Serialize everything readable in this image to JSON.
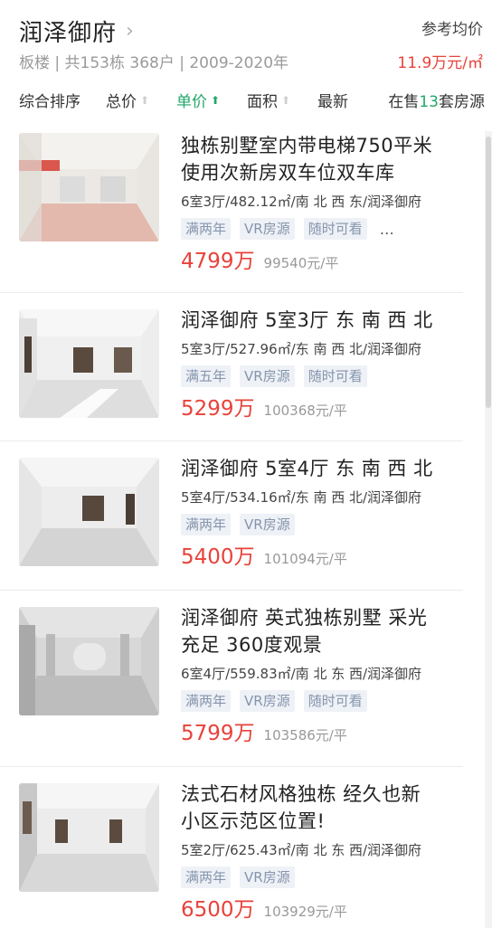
{
  "header": {
    "estate_name": "润泽御府",
    "chevron": "›",
    "sub_info": "板楼 | 共153栋 368户 | 2009-2020年",
    "ref_label": "参考均价",
    "ref_price": "11.9万元/㎡"
  },
  "sort": {
    "items": [
      {
        "label": "综合排序",
        "arrow": ""
      },
      {
        "label": "总价",
        "arrow": "⬆"
      },
      {
        "label": "单价",
        "arrow": "⬆"
      },
      {
        "label": "面积",
        "arrow": "⬆"
      },
      {
        "label": "最新",
        "arrow": ""
      }
    ],
    "onsale_prefix": "在售",
    "onsale_count": "13",
    "onsale_suffix": "套房源",
    "active_color": "#23a76a"
  },
  "listings": [
    {
      "title_line1": "独栋别墅室内带电梯750平米",
      "title_line2": "使用次新房双车位双车库",
      "meta": "6室3厅/482.12㎡/南 北 西 东/润泽御府",
      "tags": [
        "满两年",
        "VR房源",
        "随时可看"
      ],
      "more": "…",
      "price": "4799万",
      "unit_price": "99540元/平",
      "image_icon": "room-photo-icon"
    },
    {
      "title_line1": "润泽御府 5室3厅 东 南 西 北",
      "title_line2": "",
      "meta": "5室3厅/527.96㎡/东 南 西 北/润泽御府",
      "tags": [
        "满五年",
        "VR房源",
        "随时可看"
      ],
      "price": "5299万",
      "unit_price": "100368元/平",
      "image_icon": "room-photo-icon"
    },
    {
      "title_line1": "润泽御府 5室4厅 东 南 西 北",
      "title_line2": "",
      "meta": "5室4厅/534.16㎡/东 南 西 北/润泽御府",
      "tags": [
        "满两年",
        "VR房源"
      ],
      "price": "5400万",
      "unit_price": "101094元/平",
      "image_icon": "room-photo-icon"
    },
    {
      "title_line1": "润泽御府 英式独栋别墅 采光",
      "title_line2": "充足 360度观景",
      "meta": "6室4厅/559.83㎡/南 北 东 西/润泽御府",
      "tags": [
        "满两年",
        "VR房源",
        "随时可看"
      ],
      "price": "5799万",
      "unit_price": "103586元/平",
      "image_icon": "room-photo-icon"
    },
    {
      "title_line1": "法式石材风格独栋 经久也新",
      "title_line2": "小区示范区位置!",
      "meta": "5室2厅/625.43㎡/南 北 东 西/润泽御府",
      "tags": [
        "满两年",
        "VR房源"
      ],
      "price": "6500万",
      "unit_price": "103929元/平",
      "image_icon": "room-photo-icon"
    }
  ],
  "colors": {
    "price": "#e8423a",
    "accent": "#23a76a",
    "tag_bg": "#eef1f6",
    "tag_text": "#8595ad"
  }
}
